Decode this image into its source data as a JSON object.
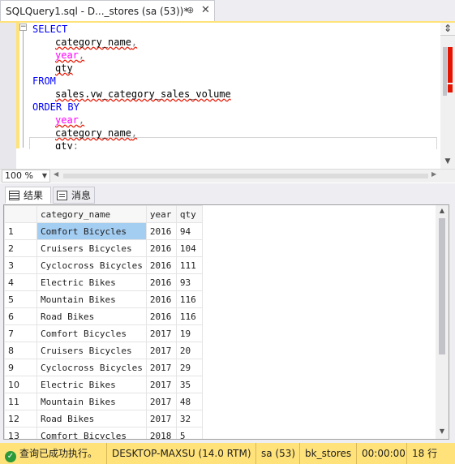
{
  "document_tab": {
    "title": "SQLQuery1.sql - D..._stores (sa (53))*",
    "pin_glyph": "⊕",
    "close_glyph": "✕"
  },
  "editor": {
    "lines": [
      {
        "indent": 0,
        "text": "SELECT",
        "kind": "keyword"
      },
      {
        "indent": 1,
        "text": "category_name",
        "trail": ","
      },
      {
        "indent": 1,
        "text": "year",
        "trail": ",",
        "pink": true
      },
      {
        "indent": 1,
        "text": "qty"
      },
      {
        "indent": 0,
        "text": "FROM",
        "kind": "keyword"
      },
      {
        "indent": 1,
        "text": "sales.vw_category_sales_volume"
      },
      {
        "indent": 0,
        "text": "ORDER BY",
        "kind": "keyword"
      },
      {
        "indent": 1,
        "text": "year",
        "trail": ",",
        "pink": true
      },
      {
        "indent": 1,
        "text": "category_name",
        "trail": ","
      },
      {
        "indent": 1,
        "text": "qty",
        "trail": ";"
      }
    ]
  },
  "zoom": {
    "value": "100 %"
  },
  "result_tabs": {
    "results_label": "结果",
    "messages_label": "消息"
  },
  "results": {
    "columns": [
      "category_name",
      "year",
      "qty"
    ],
    "rows": [
      [
        "1",
        "Comfort Bicycles",
        "2016",
        "94"
      ],
      [
        "2",
        "Cruisers Bicycles",
        "2016",
        "104"
      ],
      [
        "3",
        "Cyclocross Bicycles",
        "2016",
        "111"
      ],
      [
        "4",
        "Electric Bikes",
        "2016",
        "93"
      ],
      [
        "5",
        "Mountain Bikes",
        "2016",
        "116"
      ],
      [
        "6",
        "Road Bikes",
        "2016",
        "116"
      ],
      [
        "7",
        "Comfort Bicycles",
        "2017",
        "19"
      ],
      [
        "8",
        "Cruisers Bicycles",
        "2017",
        "20"
      ],
      [
        "9",
        "Cyclocross Bicycles",
        "2017",
        "29"
      ],
      [
        "10",
        "Electric Bikes",
        "2017",
        "35"
      ],
      [
        "11",
        "Mountain Bikes",
        "2017",
        "48"
      ],
      [
        "12",
        "Road Bikes",
        "2017",
        "32"
      ],
      [
        "13",
        "Comfort Bicycles",
        "2018",
        "5"
      ]
    ]
  },
  "status": {
    "message": "查询已成功执行。",
    "server": "DESKTOP-MAXSU (14.0 RTM)",
    "user": "sa (53)",
    "database": "bk_stores",
    "elapsed": "00:00:00",
    "rows": "18 行"
  },
  "colors": {
    "accent": "#ffe27a",
    "keyword": "#0000ff",
    "selection": "#a4cdf2",
    "ok": "#2c9a3a"
  }
}
